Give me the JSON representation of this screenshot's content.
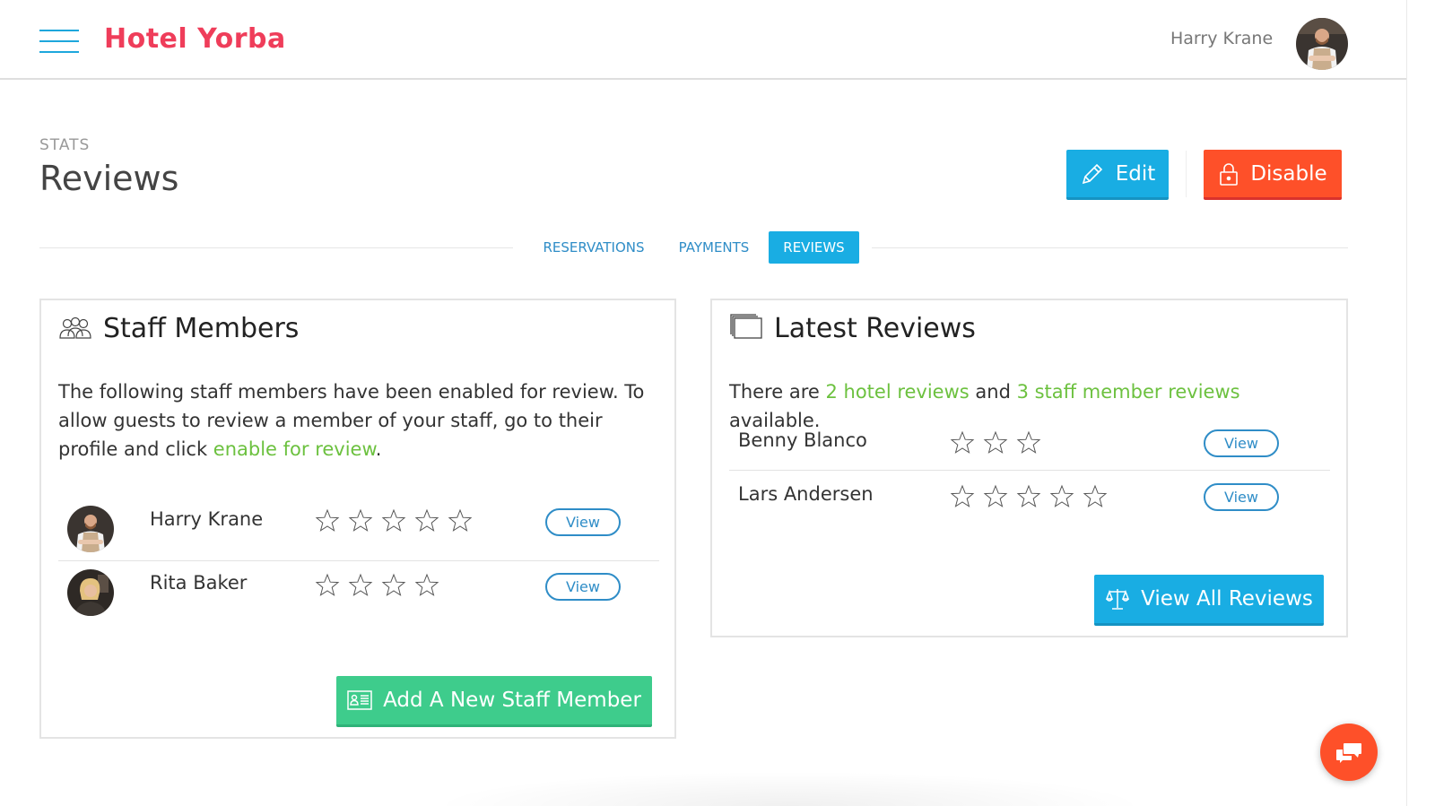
{
  "header": {
    "brand": "Hotel Yorba",
    "brand_color": "#ef3d5a",
    "user_name": "Harry Krane",
    "menu_icon": "hamburger-icon"
  },
  "page": {
    "kicker": "STATS",
    "title": "Reviews",
    "actions": {
      "edit_label": "Edit",
      "edit_icon": "pencil-icon",
      "disable_label": "Disable",
      "disable_icon": "lock-icon"
    }
  },
  "tabs": [
    {
      "label": "RESERVATIONS",
      "active": false
    },
    {
      "label": "PAYMENTS",
      "active": false
    },
    {
      "label": "REVIEWS",
      "active": true
    }
  ],
  "staff_card": {
    "title": "Staff Members",
    "icon": "users-icon",
    "description_before": "The following staff members have been enabled for review. To allow guests to review a member of your staff, go to their profile and click ",
    "description_link": "enable for review",
    "description_after": ".",
    "members": [
      {
        "name": "Harry Krane",
        "stars": 5,
        "view_label": "View"
      },
      {
        "name": "Rita Baker",
        "stars": 4,
        "view_label": "View"
      }
    ],
    "add_label": "Add A New Staff Member",
    "add_icon": "id-card-icon"
  },
  "reviews_card": {
    "title": "Latest Reviews",
    "icon": "windows-icon",
    "summary_prefix": "There are ",
    "hotel_reviews_link": "2 hotel reviews",
    "summary_middle": " and ",
    "staff_reviews_link": "3 staff member reviews",
    "summary_suffix": " available.",
    "reviews": [
      {
        "name": "Benny Blanco",
        "stars": 3,
        "view_label": "View"
      },
      {
        "name": "Lars Andersen",
        "stars": 5,
        "view_label": "View"
      }
    ],
    "view_all_label": "View All Reviews",
    "view_all_icon": "scales-icon"
  },
  "chat": {
    "icon": "chat-bubbles-icon"
  },
  "colors": {
    "primary": "#19ade3",
    "danger": "#fe5029",
    "success": "#3ecc8c",
    "link_green": "#6cc13f",
    "tab_text": "#2f8dc7"
  }
}
